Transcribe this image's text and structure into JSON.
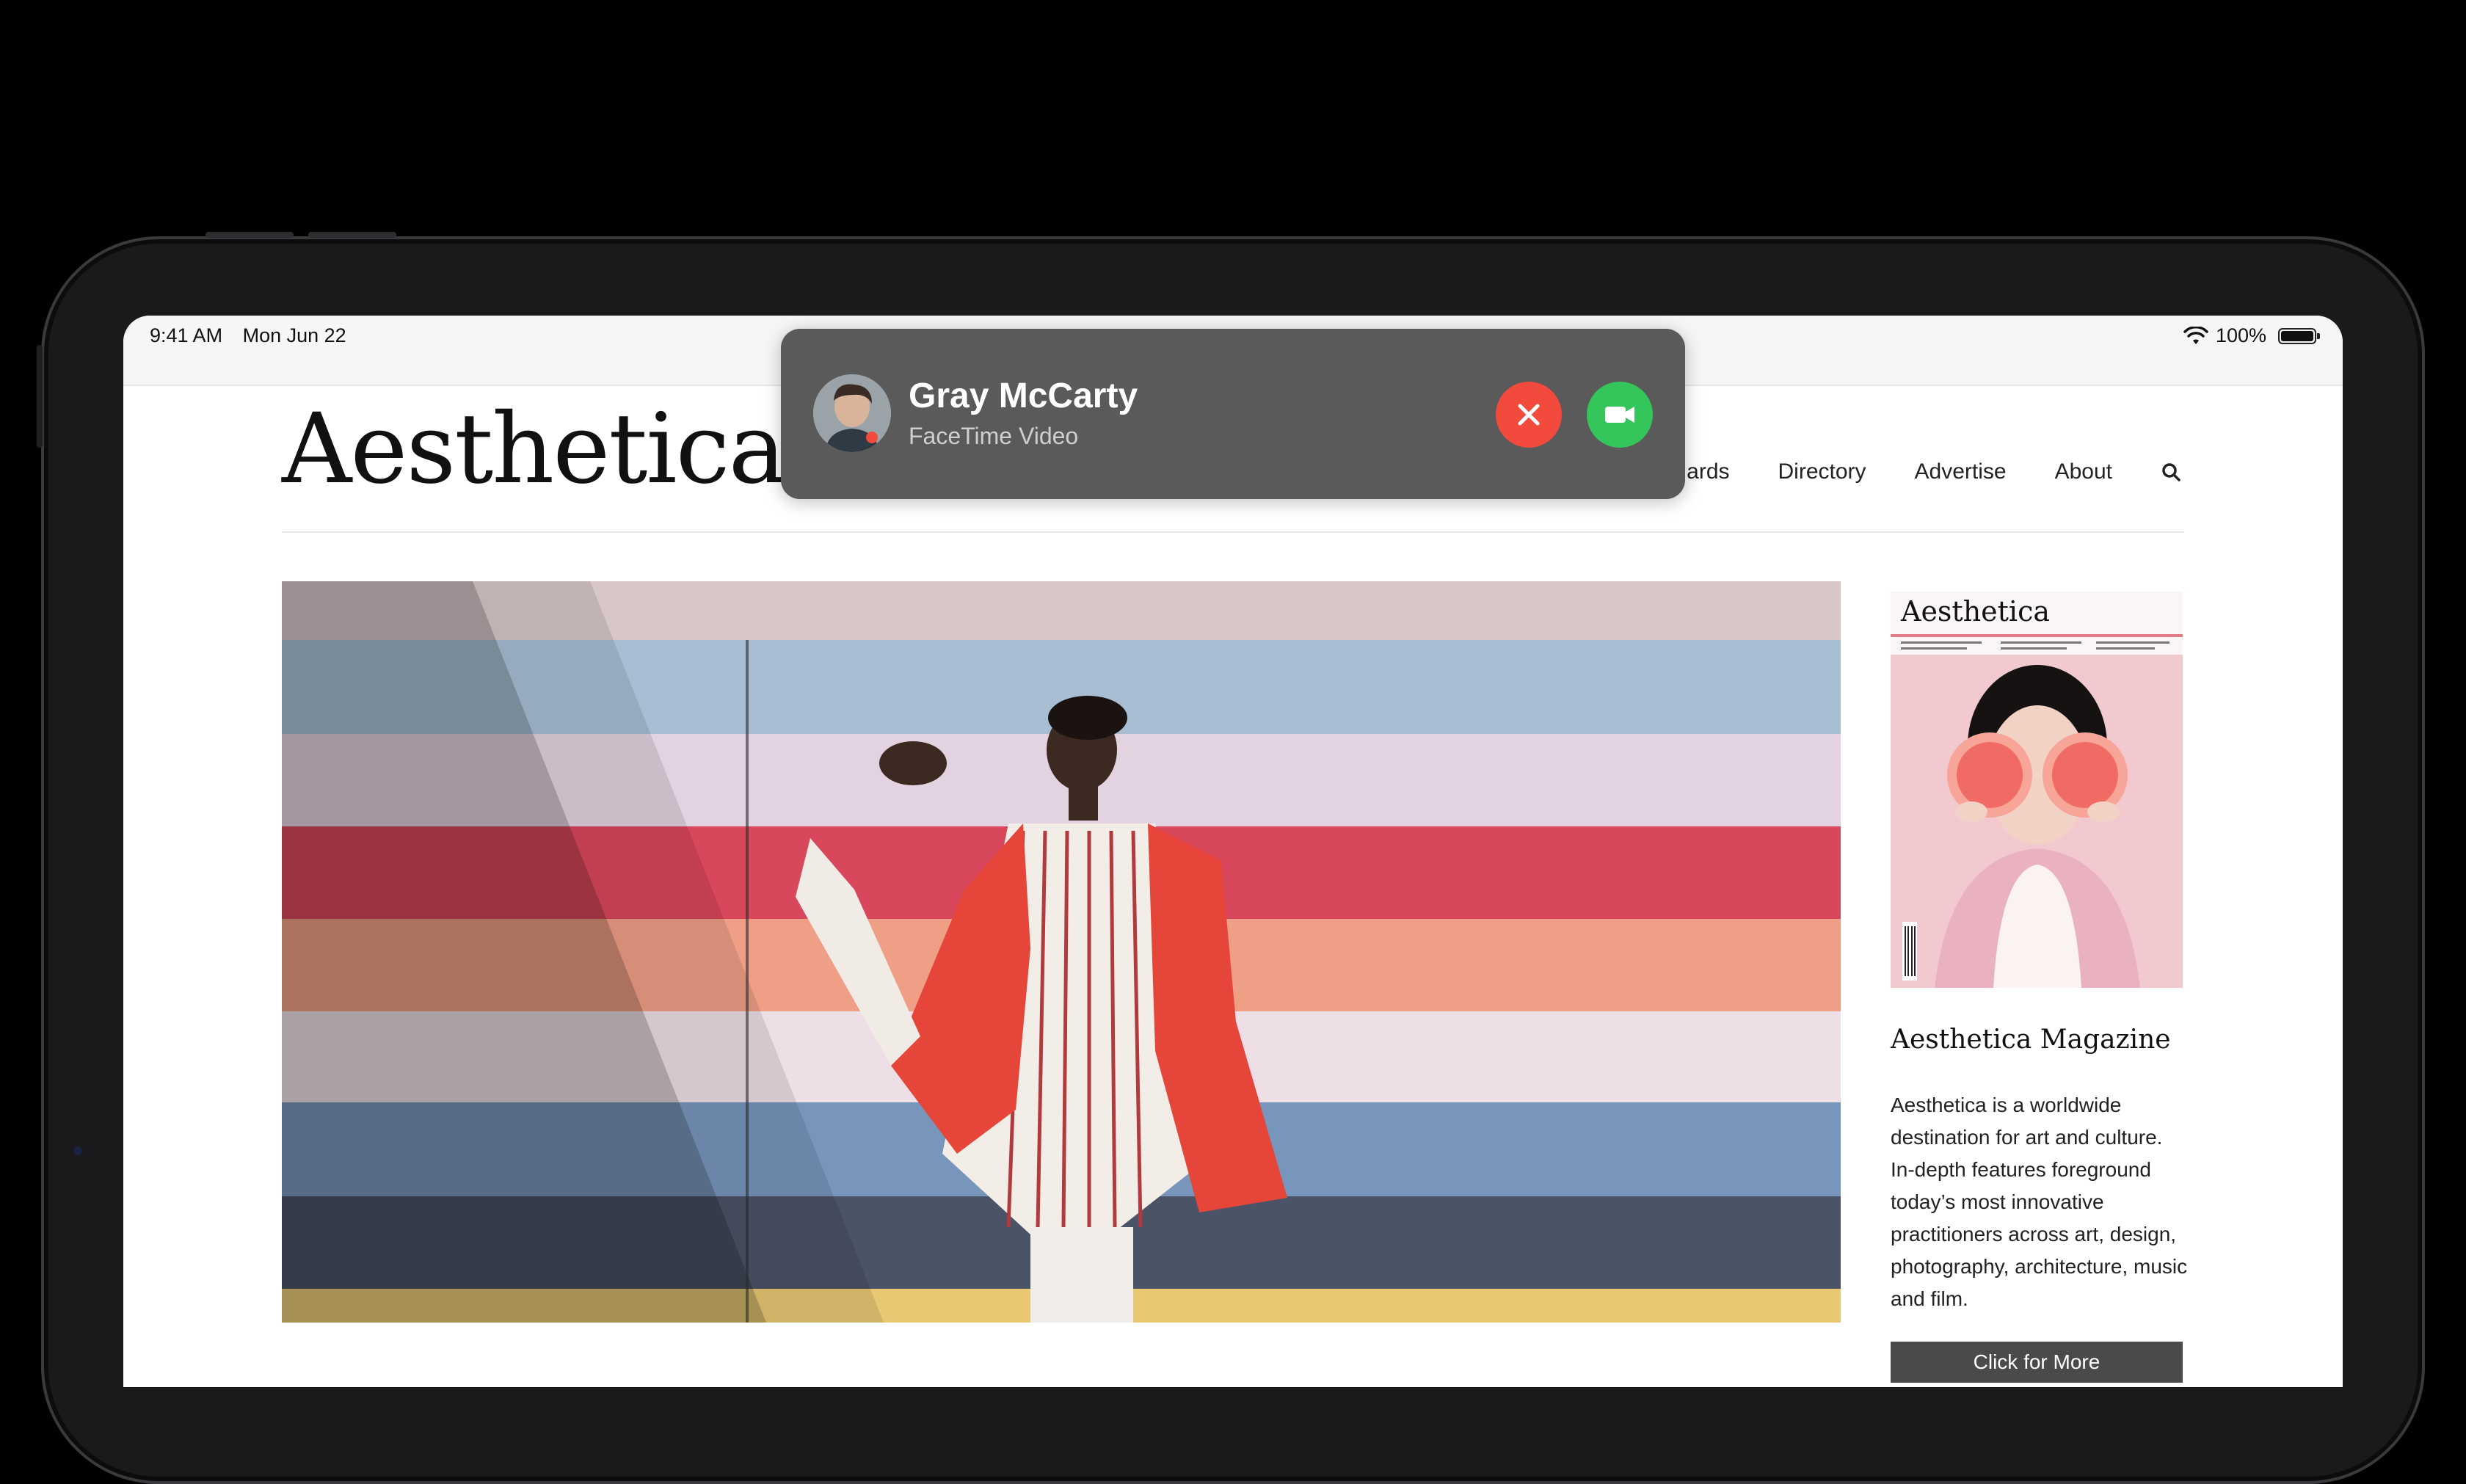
{
  "status_bar": {
    "time": "9:41 AM",
    "date": "Mon Jun 22",
    "battery": "100%"
  },
  "site": {
    "logo": "Aesthetica",
    "nav": [
      "ards",
      "Directory",
      "Advertise",
      "About"
    ]
  },
  "facetime": {
    "caller_name": "Gray McCarty",
    "call_type": "FaceTime Video",
    "decline_color": "#f24a3c",
    "accept_color": "#34c65a"
  },
  "sidebar": {
    "cover_title": "Aesthetica",
    "title": "Aesthetica Magazine",
    "description": "Aesthetica is a worldwide destination for art and culture. In-depth features foreground today’s most innovative practitioners across art, design, photography, architecture, music and film.",
    "button_label": "Click for More"
  }
}
